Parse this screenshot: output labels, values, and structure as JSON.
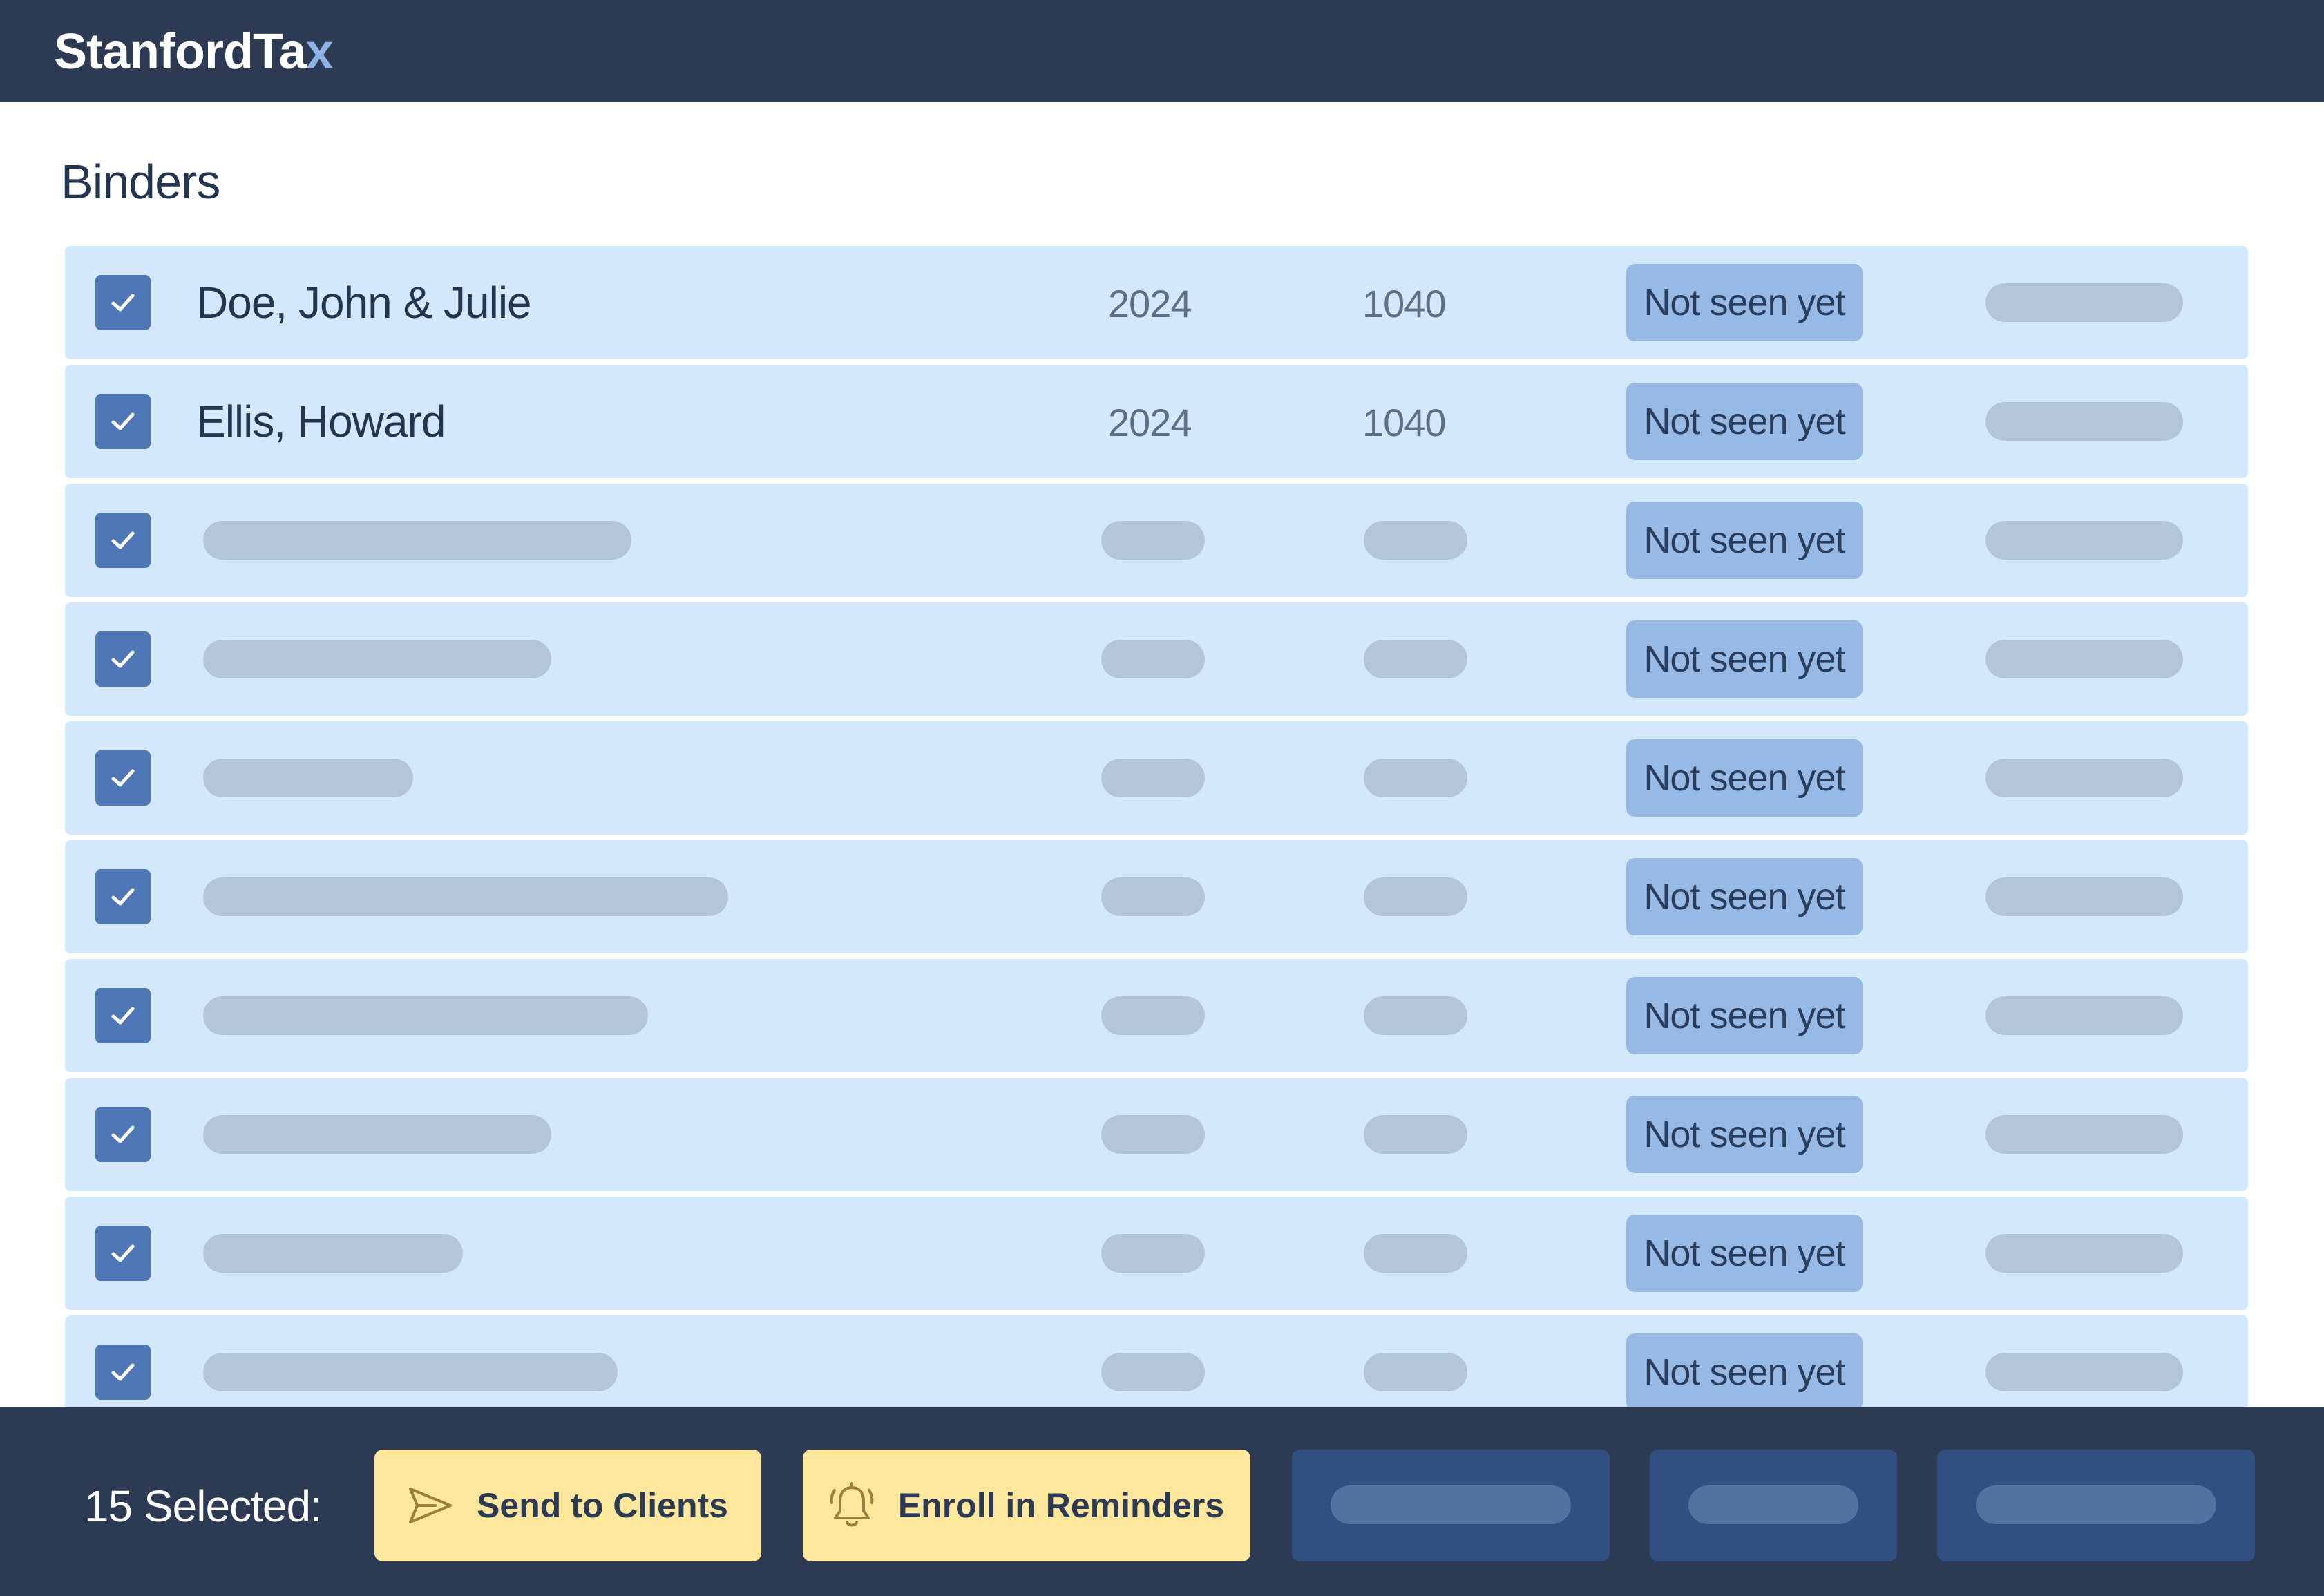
{
  "app": {
    "logo_main": "StanfordTa",
    "logo_accent": "x"
  },
  "page": {
    "title": "Binders"
  },
  "binders": [
    {
      "name": "Doe, John & Julie",
      "year": "2024",
      "form": "1040",
      "status": "Not seen yet",
      "checked": true
    },
    {
      "name": "Ellis, Howard",
      "year": "2024",
      "form": "1040",
      "status": "Not seen yet",
      "checked": true
    },
    {
      "status": "Not seen yet",
      "checked": true
    },
    {
      "status": "Not seen yet",
      "checked": true
    },
    {
      "status": "Not seen yet",
      "checked": true
    },
    {
      "status": "Not seen yet",
      "checked": true
    },
    {
      "status": "Not seen yet",
      "checked": true
    },
    {
      "status": "Not seen yet",
      "checked": true
    },
    {
      "status": "Not seen yet",
      "checked": true
    },
    {
      "status": "Not seen yet",
      "checked": true
    }
  ],
  "actions": {
    "selected_count_label": "15 Selected:",
    "send_to_clients": "Send to Clients",
    "enroll_in_reminders": "Enroll in Reminders"
  },
  "icons": {
    "checkbox": "checkmark-icon",
    "send": "send-icon",
    "reminder": "bell-icon"
  },
  "colors": {
    "navy": "#2c3a54",
    "row_bg": "#d4e8fb",
    "checkbox": "#4f77b6",
    "status_badge": "#97b9e6",
    "action_yellow": "#fce79c",
    "secondary_button": "#314f80",
    "logo_accent": "#8fb3e4"
  }
}
